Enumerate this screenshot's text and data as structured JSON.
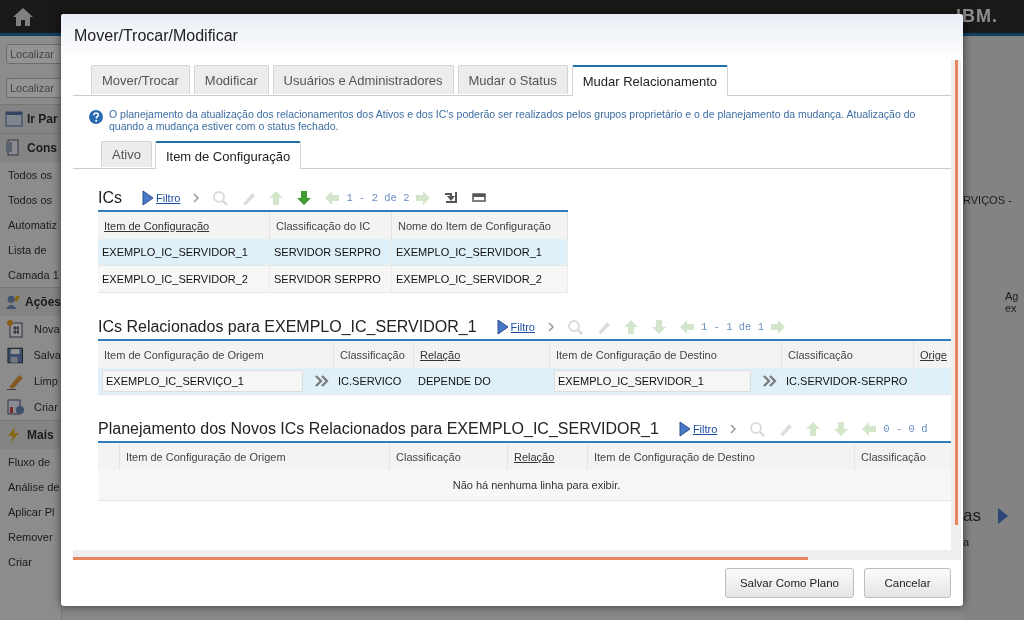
{
  "background": {
    "search_fields": [
      {
        "placeholder": "Localizar"
      },
      {
        "placeholder": "Localizar"
      }
    ],
    "sidebar": [
      {
        "label": "Ir Par"
      },
      {
        "label": "Cons",
        "items": [
          {
            "kind": "link",
            "label": "Todos os"
          },
          {
            "kind": "link",
            "label": "Todos os"
          },
          {
            "kind": "link",
            "label": "Automatiz"
          },
          {
            "kind": "link",
            "label": "Lista de"
          },
          {
            "kind": "link",
            "label": "Camada 1"
          }
        ]
      },
      {
        "label": "Ações",
        "items": [
          {
            "kind": "action",
            "label": "Nova"
          },
          {
            "kind": "action",
            "label": "Salva"
          },
          {
            "kind": "action",
            "label": "Limp"
          },
          {
            "kind": "action",
            "label": "Criar"
          }
        ]
      },
      {
        "label": "Mais",
        "items": [
          {
            "kind": "link",
            "label": "Fluxo de"
          },
          {
            "kind": "link",
            "label": "Análise de"
          },
          {
            "kind": "link",
            "label": "Aplicar Pl"
          },
          {
            "kind": "link",
            "label": "Remover"
          },
          {
            "kind": "link",
            "label": "Criar"
          }
        ]
      }
    ],
    "logo": "IBM.",
    "right_texts": [
      "RVIÇOS -",
      "Ag",
      "ex",
      "as",
      "a"
    ]
  },
  "window": {
    "title": "Mover/Trocar/Modificar"
  },
  "tabs": [
    {
      "label": "Mover/Trocar",
      "selected": false
    },
    {
      "label": "Modificar",
      "selected": false
    },
    {
      "label": "Usuários e Administradores",
      "selected": false
    },
    {
      "label": "Mudar o Status",
      "selected": false
    },
    {
      "label": "Mudar Relacionamento",
      "selected": true
    }
  ],
  "info": {
    "lines": [
      "O planejamento da atualização dos relacionamentos dos Ativos e dos IC's poderão ser realizados pelos grupos proprietário e o de planejamento da mudança. Atualização do",
      "quando a mudança estiver com o status fechado."
    ]
  },
  "subtabs": [
    {
      "label": "Ativo",
      "selected": false
    },
    {
      "label": "Item de Configuração",
      "selected": true
    }
  ],
  "sections": [
    {
      "title": "ICs",
      "filter": "Filtro",
      "tools": [
        {
          "kind": "search",
          "disabled": true
        },
        {
          "kind": "clear",
          "disabled": true
        },
        {
          "kind": "up",
          "disabled": true
        },
        {
          "kind": "down",
          "disabled": false
        },
        {
          "kind": "prev",
          "disabled": true
        },
        {
          "kind": "pager",
          "text": "1 - 2 de 2"
        },
        {
          "kind": "next",
          "disabled": true
        },
        {
          "kind": "download",
          "disabled": false
        },
        {
          "kind": "collapse",
          "disabled": false
        }
      ],
      "columns": [
        {
          "label": "Item de Configuração",
          "sortable": true
        },
        {
          "label": "Classificação do IC",
          "sortable": false
        },
        {
          "label": "Nome do Item de Configuração",
          "sortable": false
        }
      ],
      "rows": [
        {
          "selected": true,
          "cells": [
            {
              "kind": "text",
              "text": "EXEMPLO_IC_SERVIDOR_1"
            },
            {
              "kind": "text",
              "text": "SERVIDOR SERPRO"
            },
            {
              "kind": "text",
              "text": "EXEMPLO_IC_SERVIDOR_1"
            }
          ]
        },
        {
          "selected": false,
          "cells": [
            {
              "kind": "text",
              "text": "EXEMPLO_IC_SERVIDOR_2"
            },
            {
              "kind": "text",
              "text": "SERVIDOR SERPRO"
            },
            {
              "kind": "text",
              "text": "EXEMPLO_IC_SERVIDOR_2"
            }
          ]
        }
      ]
    },
    {
      "title": "ICs Relacionados para EXEMPLO_IC_SERVIDOR_1",
      "filter": "Filtro",
      "tools": [
        {
          "kind": "search",
          "disabled": true
        },
        {
          "kind": "clear",
          "disabled": true
        },
        {
          "kind": "up",
          "disabled": true
        },
        {
          "kind": "down",
          "disabled": true
        },
        {
          "kind": "prev",
          "disabled": true
        },
        {
          "kind": "pager",
          "text": "1 - 1 de 1"
        },
        {
          "kind": "next",
          "disabled": true
        }
      ],
      "columns": [
        {
          "label": "Item de Configuração de Origem",
          "sortable": false
        },
        {
          "label": "Classificação",
          "sortable": false
        },
        {
          "label": "Relação",
          "sortable": true
        },
        {
          "label": "Item de Configuração de Destino",
          "sortable": false
        },
        {
          "label": "Classificação",
          "sortable": false
        },
        {
          "label": "Orige",
          "sortable": true
        }
      ],
      "rows": [
        {
          "selected": true,
          "cells": [
            {
              "kind": "field",
              "text": "EXEMPLO_IC_SERVIÇO_1"
            },
            {
              "kind": "text",
              "text": "IC.SERVICO"
            },
            {
              "kind": "text",
              "text": "DEPENDE DO"
            },
            {
              "kind": "field",
              "text": "EXEMPLO_IC_SERVIDOR_1"
            },
            {
              "kind": "text",
              "text": "IC.SERVIDOR-SERPRO"
            },
            {
              "kind": "text"
            }
          ]
        }
      ]
    },
    {
      "title": "Planejamento dos Novos ICs Relacionados para EXEMPLO_IC_SERVIDOR_1",
      "filter": "Filtro",
      "tools": [
        {
          "kind": "search",
          "disabled": true
        },
        {
          "kind": "clear",
          "disabled": true
        },
        {
          "kind": "up",
          "disabled": true
        },
        {
          "kind": "down",
          "disabled": true
        },
        {
          "kind": "prev",
          "disabled": true
        },
        {
          "kind": "pager",
          "text": "0 - 0 d"
        }
      ],
      "columns": [
        {},
        {
          "label": "Item de Configuração de Origem",
          "sortable": false
        },
        {
          "label": "Classificação",
          "sortable": false
        },
        {
          "label": "Relação",
          "sortable": true
        },
        {
          "label": "Item de Configuração de Destino",
          "sortable": false
        },
        {
          "label": "Classificação",
          "sortable": false
        }
      ],
      "empty": "Não há nenhuma linha para exibir."
    }
  ],
  "buttons": [
    "Salvar Como Plano",
    "Cancelar"
  ]
}
